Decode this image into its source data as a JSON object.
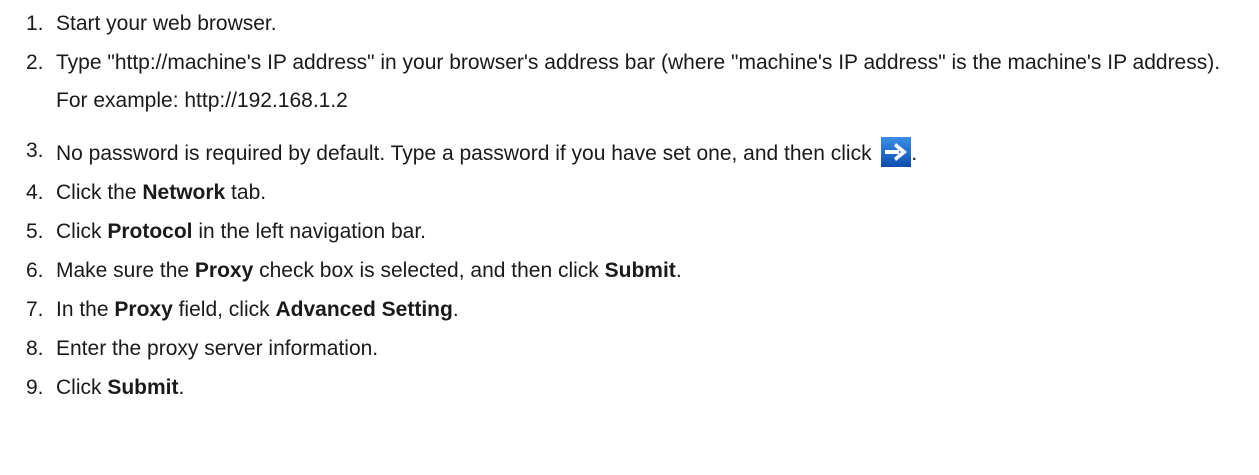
{
  "steps": [
    {
      "num": "1.",
      "parts": [
        "Start your web browser."
      ]
    },
    {
      "num": "2.",
      "parts": [
        "Type \"http://machine's IP address\" in your browser's address bar (where \"machine's IP address\" is the machine's IP address)."
      ],
      "sub": "For example: http://192.168.1.2"
    },
    {
      "num": "3.",
      "parts": [
        "No password is required by default. Type a password if you have set one, and then click ",
        "."
      ]
    },
    {
      "num": "4.",
      "parts": [
        "Click the ",
        "Network",
        " tab."
      ]
    },
    {
      "num": "5.",
      "parts": [
        "Click ",
        "Protocol",
        " in the left navigation bar."
      ]
    },
    {
      "num": "6.",
      "parts": [
        "Make sure the ",
        "Proxy",
        " check box is selected, and then click ",
        "Submit",
        "."
      ]
    },
    {
      "num": "7.",
      "parts": [
        "In the ",
        "Proxy",
        " field, click ",
        "Advanced Setting",
        "."
      ]
    },
    {
      "num": "8.",
      "parts": [
        "Enter the proxy server information."
      ]
    },
    {
      "num": "9.",
      "parts": [
        "Click ",
        "Submit",
        "."
      ]
    }
  ],
  "icons": {
    "login_arrow": "right-arrow-icon",
    "login_arrow_color": "#1f6fd1"
  }
}
